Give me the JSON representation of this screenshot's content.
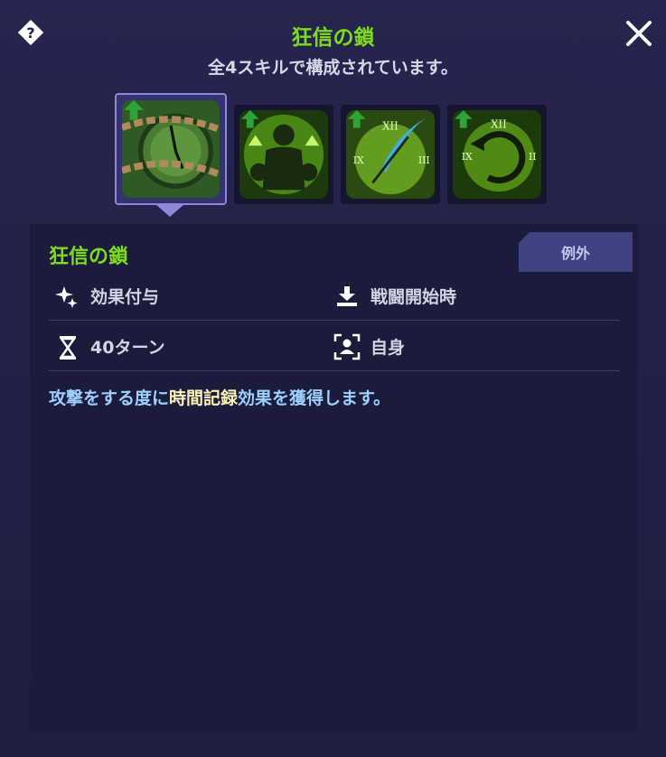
{
  "header": {
    "title": "狂信の鎖",
    "subtitle": "全4スキルで構成されています。"
  },
  "skills": [
    {
      "name": "chain-clock-skill",
      "selected": true
    },
    {
      "name": "flexing-figure-skill",
      "selected": false
    },
    {
      "name": "clock-feather-skill",
      "selected": false
    },
    {
      "name": "rewind-clock-skill",
      "selected": false
    }
  ],
  "detail": {
    "tag": "例外",
    "name": "狂信の鎖",
    "effect_type": "効果付与",
    "timing": "戦闘開始時",
    "duration": "40ターン",
    "target": "自身",
    "desc_prefix": "攻撃をする度に",
    "desc_highlight": "時間記録",
    "desc_suffix": "効果を獲得します。"
  },
  "colors": {
    "title": "#7fdc1c",
    "highlight": "#fff2b8",
    "desc": "#9ed0ff",
    "tag_bg": "#3f4280"
  }
}
